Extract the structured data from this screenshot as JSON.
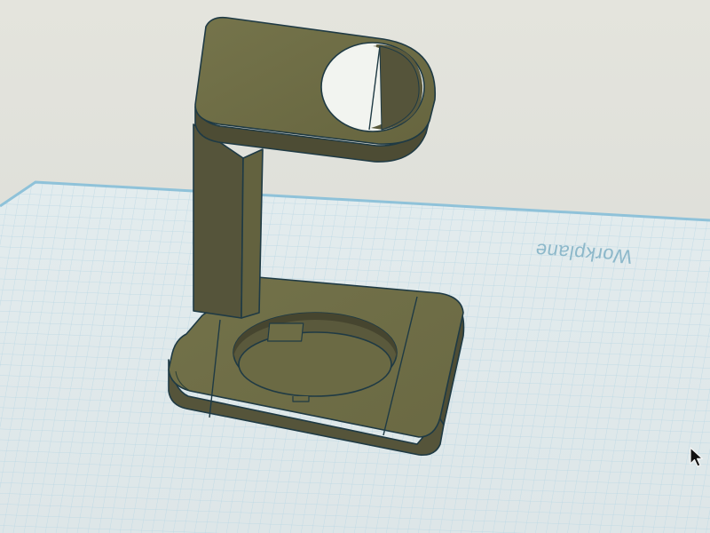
{
  "workplane": {
    "label": "Workplane",
    "grid_color": "#a9cde0",
    "plane_color": "#dfe9ec",
    "edge_color": "#8fc2d9"
  },
  "model": {
    "face_color": "#6d6c45",
    "side_color": "#55543a",
    "dark_color": "#3e3e2a",
    "outline_color": "#1f3a44"
  },
  "cursor": {
    "icon": "arrow-cursor-icon"
  }
}
